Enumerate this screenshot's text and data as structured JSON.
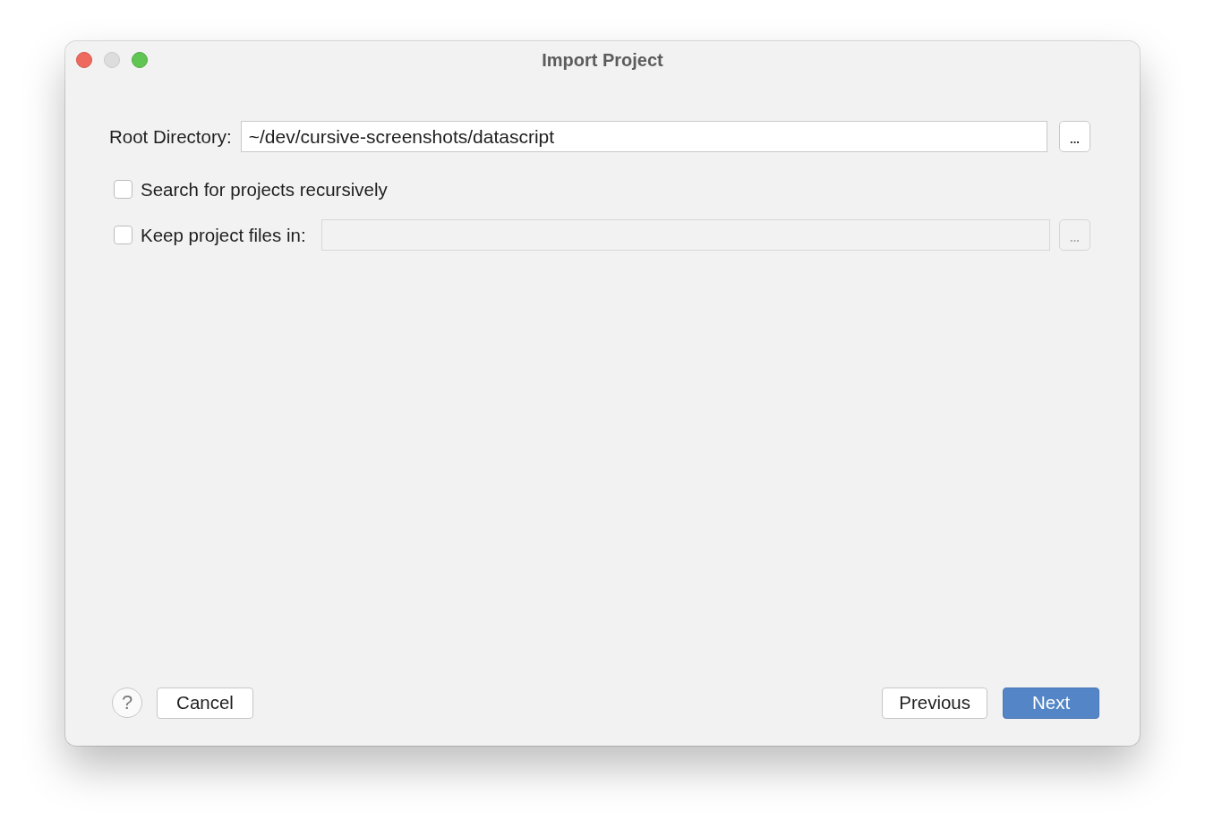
{
  "window": {
    "title": "Import Project",
    "controls": [
      {
        "kind": "close",
        "disabled": false
      },
      {
        "kind": "minimize",
        "disabled": true
      },
      {
        "kind": "zoom",
        "disabled": false
      }
    ]
  },
  "root_directory": {
    "label": "Root Directory:",
    "value": "~/dev/cursive-screenshots/datascript",
    "browse_button": {
      "label": "...",
      "disabled": false
    }
  },
  "options": [
    {
      "kind": "checkbox",
      "label": "Search for projects recursively",
      "checked": false
    },
    {
      "kind": "checkbox_path",
      "label": "Keep project files in:",
      "checked": false,
      "path_field": {
        "disabled": true
      },
      "browse_button": {
        "label": "...",
        "disabled": true
      }
    }
  ],
  "footer": {
    "help_button": {
      "label": "?"
    },
    "left_buttons": [
      {
        "label": "Cancel",
        "default": false
      }
    ],
    "right_buttons": [
      {
        "label": "Previous",
        "default": false
      },
      {
        "label": "Next",
        "default": true
      }
    ]
  }
}
